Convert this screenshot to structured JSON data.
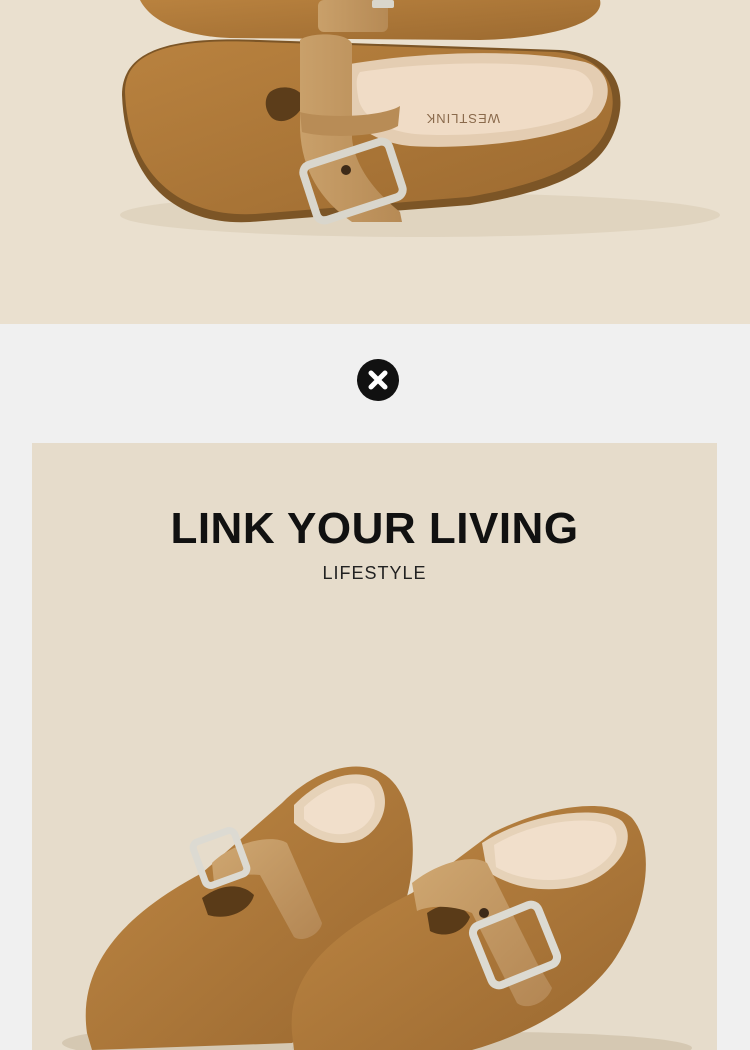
{
  "top_photo": {
    "insole_brand": "WESTLINK"
  },
  "divider": {
    "icon": "close-icon"
  },
  "lifestyle_panel": {
    "headline": "LINK YOUR LIVING",
    "subheadline": "LIFESTYLE"
  },
  "colors": {
    "top_background": "#eae0cf",
    "band_background": "#f0f0f0",
    "panel_background": "#e6dccb",
    "suede": "#b07a3c",
    "strap_leather": "#c69a62",
    "buckle_silver": "#d9d6cc"
  }
}
